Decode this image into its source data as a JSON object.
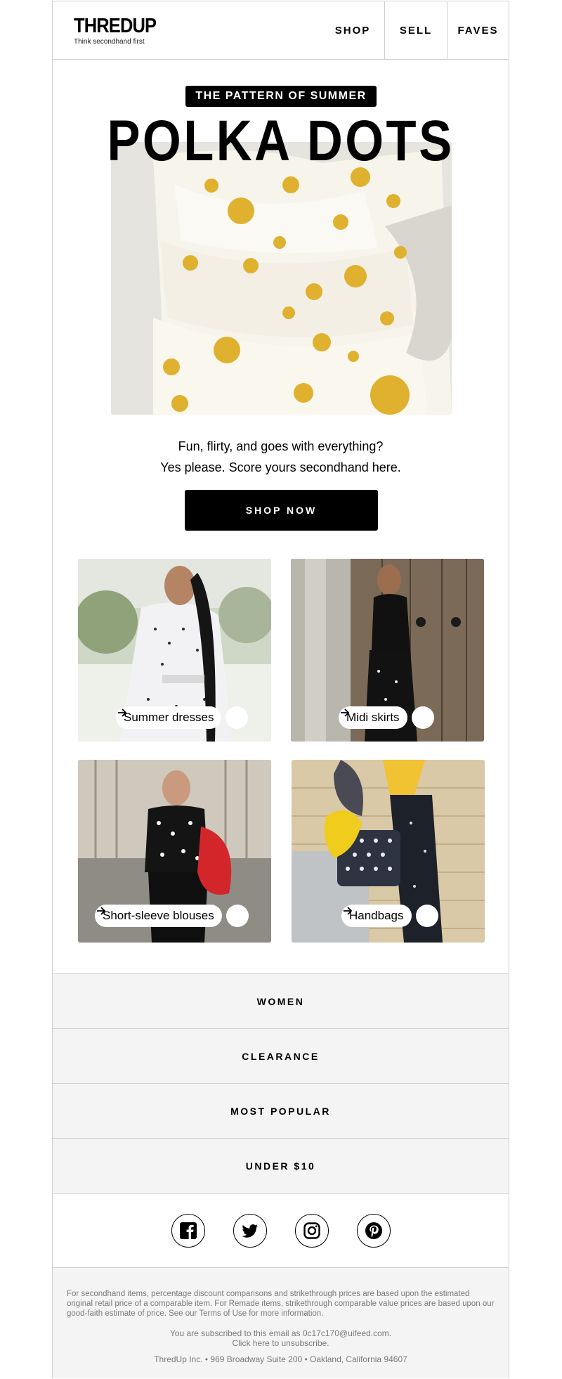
{
  "brand": {
    "logo_text": "THREDUP",
    "tagline": "Think secondhand first"
  },
  "nav": {
    "shop": "SHOP",
    "sell": "SELL",
    "faves": "FAVES"
  },
  "hero": {
    "eyebrow": "THE PATTERN OF SUMMER",
    "title": "POLKA DOTS",
    "line1": "Fun, flirty, and goes with everything?",
    "line2": "Yes please. Score yours secondhand here.",
    "cta": "SHOP NOW"
  },
  "tiles": [
    {
      "label": "Summer dresses"
    },
    {
      "label": "Midi skirts"
    },
    {
      "label": "Short-sleeve blouses"
    },
    {
      "label": "Handbags"
    }
  ],
  "categories": [
    "WOMEN",
    "CLEARANCE",
    "MOST POPULAR",
    "UNDER $10"
  ],
  "social": [
    "facebook-icon",
    "twitter-icon",
    "instagram-icon",
    "pinterest-icon"
  ],
  "footer": {
    "disclaimer": "For secondhand items, percentage discount comparisons and strikethrough prices are based upon the estimated original retail price of a comparable item. For Remade items, strikethrough comparable value prices are based upon our good-faith estimate of price. See our Terms of Use for more information.",
    "subscribed": "You are subscribed to this email as 0c17c170@uifeed.com.",
    "unsubscribe": "Click here to unsubscribe.",
    "address": "ThredUp Inc. • 969 Broadway Suite 200 • Oakland, California 94607"
  }
}
